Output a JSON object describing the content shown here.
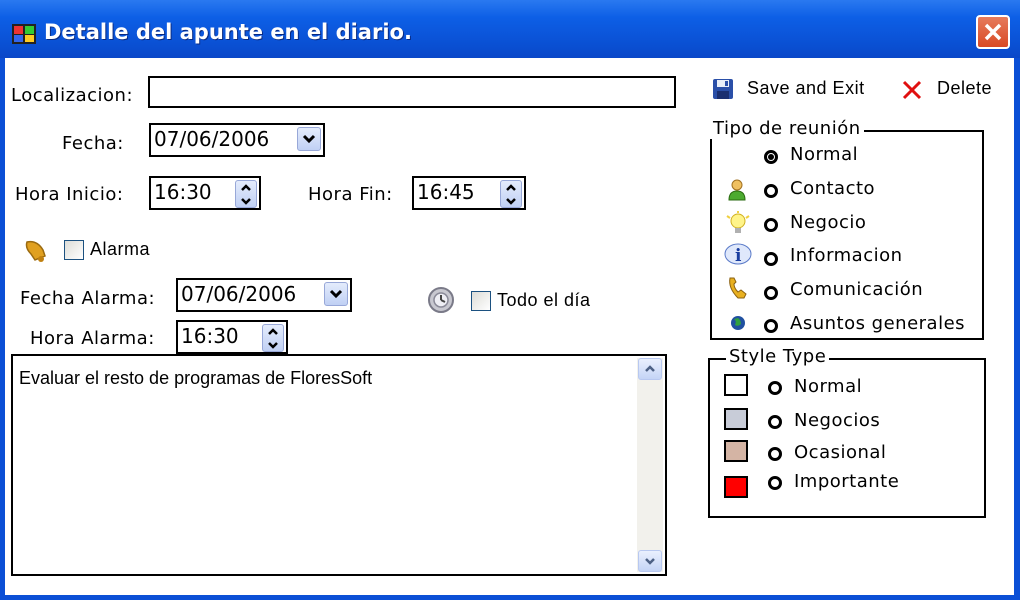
{
  "window": {
    "title": "Detalle del apunte en el diario."
  },
  "form": {
    "localizacion_label": "Localizacion:",
    "localizacion_value": "",
    "fecha_label": "Fecha:",
    "fecha_value": "07/06/2006",
    "hora_inicio_label": "Hora Inicio:",
    "hora_inicio_value": "16:30",
    "hora_fin_label": "Hora Fin:",
    "hora_fin_value": "16:45",
    "alarma_label": "Alarma",
    "alarma_checked": false,
    "fecha_alarma_label": "Fecha Alarma:",
    "fecha_alarma_value": "07/06/2006",
    "hora_alarma_label": "Hora Alarma:",
    "hora_alarma_value": "16:30",
    "todo_el_dia_label": "Todo el día",
    "todo_el_dia_checked": false,
    "notes": "Evaluar el resto de programas de FloresSoft"
  },
  "toolbar": {
    "save_label": "Save and Exit",
    "delete_label": "Delete"
  },
  "tipo_reunion": {
    "title": "Tipo de reunión",
    "options": [
      {
        "label": "Normal",
        "selected": true,
        "icon": "none"
      },
      {
        "label": "Contacto",
        "selected": false,
        "icon": "person-icon"
      },
      {
        "label": "Negocio",
        "selected": false,
        "icon": "lightbulb-icon"
      },
      {
        "label": "Informacion",
        "selected": false,
        "icon": "info-icon"
      },
      {
        "label": "Comunicación",
        "selected": false,
        "icon": "phone-icon"
      },
      {
        "label": "Asuntos generales",
        "selected": false,
        "icon": "globe-icon"
      }
    ]
  },
  "style_type": {
    "title": "Style Type",
    "options": [
      {
        "label": "Normal",
        "color": "#ffffff"
      },
      {
        "label": "Negocios",
        "color": "#c8ccd8"
      },
      {
        "label": "Ocasional",
        "color": "#d4b4a4"
      },
      {
        "label": "Importante",
        "color": "#ff0000"
      }
    ]
  }
}
